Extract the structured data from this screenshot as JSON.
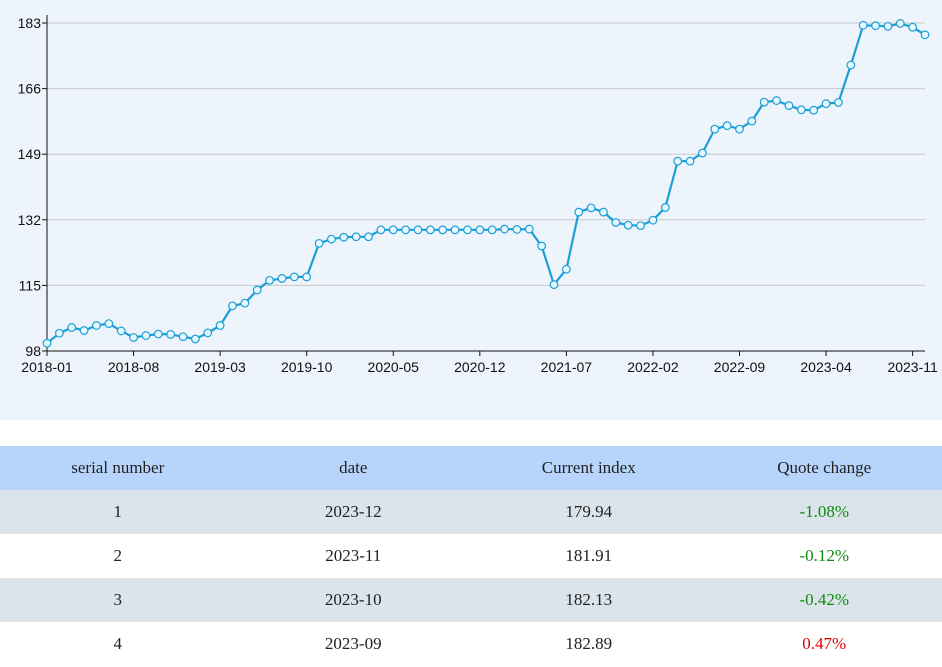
{
  "chart_data": {
    "type": "line",
    "x_ticks": [
      "2018-01",
      "2018-08",
      "2019-03",
      "2019-10",
      "2020-05",
      "2020-12",
      "2021-07",
      "2022-02",
      "2022-09",
      "2023-04",
      "2023-11"
    ],
    "y_ticks": [
      98,
      115,
      132,
      149,
      166,
      183
    ],
    "ylim": [
      98,
      183
    ],
    "grid": true,
    "series": [
      {
        "color": "#1a9fd8",
        "x": [
          "2018-01",
          "2018-02",
          "2018-03",
          "2018-04",
          "2018-05",
          "2018-06",
          "2018-07",
          "2018-08",
          "2018-09",
          "2018-10",
          "2018-11",
          "2018-12",
          "2019-01",
          "2019-02",
          "2019-03",
          "2019-04",
          "2019-05",
          "2019-06",
          "2019-07",
          "2019-08",
          "2019-09",
          "2019-10",
          "2019-11",
          "2019-12",
          "2020-01",
          "2020-02",
          "2020-03",
          "2020-04",
          "2020-05",
          "2020-06",
          "2020-07",
          "2020-08",
          "2020-09",
          "2020-10",
          "2020-11",
          "2020-12",
          "2021-01",
          "2021-02",
          "2021-03",
          "2021-04",
          "2021-05",
          "2021-06",
          "2021-07",
          "2021-08",
          "2021-09",
          "2021-10",
          "2021-11",
          "2021-12",
          "2022-01",
          "2022-02",
          "2022-03",
          "2022-04",
          "2022-05",
          "2022-06",
          "2022-07",
          "2022-08",
          "2022-09",
          "2022-10",
          "2022-11",
          "2022-12",
          "2023-01",
          "2023-02",
          "2023-03",
          "2023-04",
          "2023-05",
          "2023-06",
          "2023-07",
          "2023-08",
          "2023-09",
          "2023-10",
          "2023-11",
          "2023-12"
        ],
        "values": [
          100.0,
          102.6,
          104.1,
          103.3,
          104.6,
          105.1,
          103.2,
          101.5,
          102.0,
          102.4,
          102.3,
          101.7,
          101.1,
          102.7,
          104.6,
          109.7,
          110.4,
          113.8,
          116.3,
          116.8,
          117.2,
          117.2,
          125.9,
          127.0,
          127.5,
          127.6,
          127.6,
          129.4,
          129.4,
          129.4,
          129.4,
          129.4,
          129.4,
          129.4,
          129.4,
          129.4,
          129.4,
          129.6,
          129.5,
          129.6,
          125.2,
          115.2,
          119.2,
          134.0,
          135.1,
          134.0,
          131.3,
          130.6,
          130.5,
          131.9,
          135.2,
          147.2,
          147.2,
          149.3,
          155.5,
          156.4,
          155.5,
          157.6,
          162.5,
          162.9,
          161.6,
          160.5,
          160.4,
          162.1,
          162.4,
          172.1,
          182.4,
          182.3,
          182.13,
          182.89,
          181.91,
          179.94
        ]
      }
    ],
    "table": {
      "columns": [
        "serial number",
        "date",
        "Current index",
        "Quote change"
      ],
      "rows": [
        {
          "serial": "1",
          "date": "2023-12",
          "index": "179.94",
          "change": "-1.08%",
          "direction": "down"
        },
        {
          "serial": "2",
          "date": "2023-11",
          "index": "181.91",
          "change": "-0.12%",
          "direction": "down"
        },
        {
          "serial": "3",
          "date": "2023-10",
          "index": "182.13",
          "change": "-0.42%",
          "direction": "down"
        },
        {
          "serial": "4",
          "date": "2023-09",
          "index": "182.89",
          "change": "0.47%",
          "direction": "up"
        }
      ]
    },
    "colors": {
      "line": "#1a9fd8",
      "marker_fill": "#e8f8ff",
      "negative": "#108a10",
      "positive": "#e00000",
      "header_bg": "#b7d5fb",
      "panel_bg": "#eef4fb"
    }
  }
}
